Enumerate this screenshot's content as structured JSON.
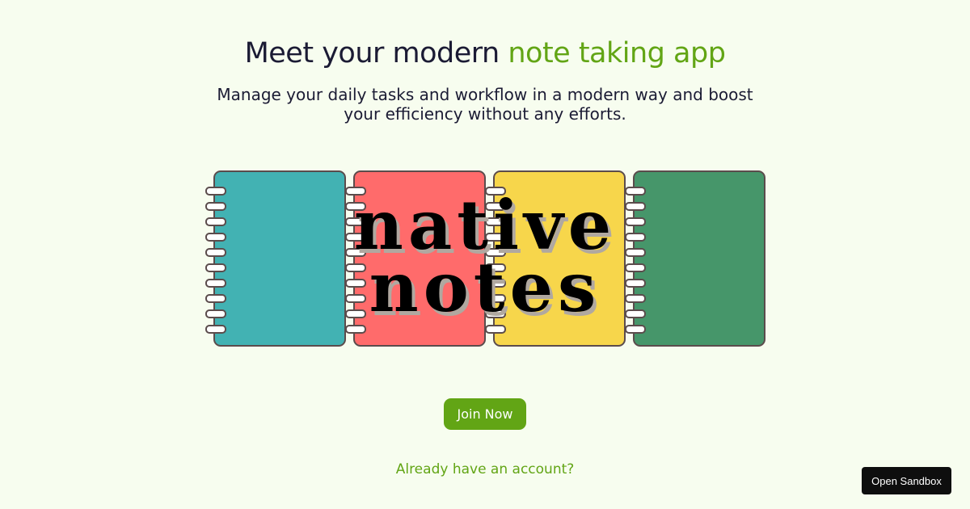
{
  "hero": {
    "title_prefix": "Meet your modern ",
    "title_accent": "note taking app",
    "subtitle": "Manage your daily tasks and workflow in a modern way and boost your efficiency without any efforts."
  },
  "logo": {
    "line1": "native",
    "line2": "notes"
  },
  "notebooks": [
    {
      "name": "teal",
      "color": "#42b2b3"
    },
    {
      "name": "coral",
      "color": "#ff6b6b"
    },
    {
      "name": "yellow",
      "color": "#f7d64b"
    },
    {
      "name": "green",
      "color": "#46966a"
    }
  ],
  "cta": {
    "join_label": "Join Now",
    "login_label": "Already have an account?"
  },
  "sandbox": {
    "label": "Open Sandbox"
  },
  "colors": {
    "background": "#f7fdef",
    "accent": "#62a515",
    "text": "#1b1b34",
    "outline": "#5b4c4c"
  }
}
